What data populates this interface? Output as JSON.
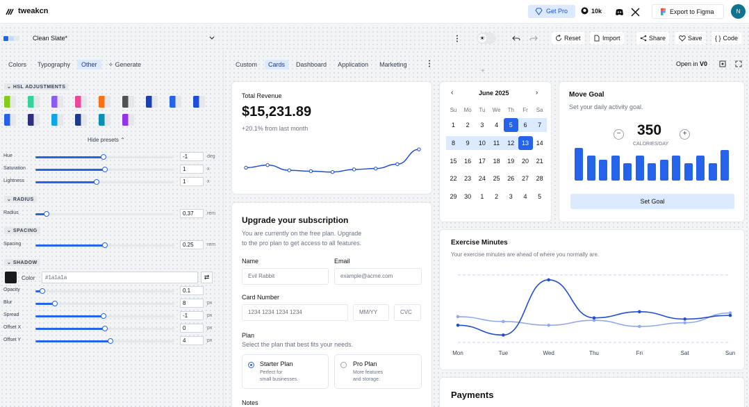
{
  "app": {
    "brand": "tweakcn"
  },
  "topbar": {
    "get_pro": "Get Pro",
    "github_stars": "10k",
    "export": "Export to Figma",
    "avatar": "N"
  },
  "toolbar": {
    "theme_name": "Clean Slate*",
    "reset": "Reset",
    "import": "Import",
    "share": "Share",
    "save": "Save",
    "code": "Code",
    "swatch_colors": [
      "#2563eb",
      "#bfdbfe",
      "#e5e7eb"
    ]
  },
  "left": {
    "tabs": [
      "Colors",
      "Typography",
      "Other",
      "Generate"
    ],
    "active_tab": "Other",
    "hsl_title": "HSL ADJUSTMENTS",
    "presets_row1": [
      "#84cc16",
      "#34d399",
      "#8b5cf6",
      "#ec4899",
      "#f97316",
      "#525252",
      "#1e40af",
      "#2563eb",
      "#1d4ed8"
    ],
    "presets_row2": [
      "#2563eb",
      "#312e81",
      "#0ea5e9",
      "#1e3a8a",
      "#0891b2",
      "#9333ea"
    ],
    "hide_presets": "Hide presets",
    "sliders": {
      "hue": {
        "label": "Hue",
        "value": "-1",
        "unit": "deg",
        "pct": 0.49
      },
      "saturation": {
        "label": "Saturation",
        "value": "1",
        "unit": "x",
        "pct": 0.5
      },
      "lightness": {
        "label": "Lightness",
        "value": "1",
        "unit": "x",
        "pct": 0.44
      }
    },
    "radius_title": "RADIUS",
    "radius": {
      "label": "Radius",
      "value": "0.37",
      "unit": "rem",
      "pct": 0.08
    },
    "spacing_title": "SPACING",
    "spacing": {
      "label": "Spacing",
      "value": "0.25",
      "unit": "rem",
      "pct": 0.5
    },
    "shadow_title": "SHADOW",
    "shadow_color": {
      "label": "Color",
      "value": "#1a1a1a"
    },
    "shadow": {
      "opacity": {
        "label": "Opacity",
        "value": "0.1",
        "unit": "",
        "pct": 0.05
      },
      "blur": {
        "label": "Blur",
        "value": "8",
        "unit": "px",
        "pct": 0.14
      },
      "spread": {
        "label": "Spread",
        "value": "-1",
        "unit": "px",
        "pct": 0.49
      },
      "offset_x": {
        "label": "Offset X",
        "value": "0",
        "unit": "px",
        "pct": 0.5
      },
      "offset_y": {
        "label": "Offset Y",
        "value": "4",
        "unit": "px",
        "pct": 0.54
      }
    }
  },
  "center_tabs": [
    "Custom",
    "Cards",
    "Dashboard",
    "Application",
    "Marketing"
  ],
  "center_active": "Cards",
  "open_in": "Open in",
  "revenue": {
    "title": "Total Revenue",
    "amount": "$15,231.89",
    "change": "+20.1% from last month"
  },
  "upgrade": {
    "title": "Upgrade your subscription",
    "desc1": "You are currently on the free plan. Upgrade",
    "desc2": "to the pro plan to get access to all features.",
    "name_label": "Name",
    "name_value": "Evil Rabbit",
    "email_label": "Email",
    "email_placeholder": "example@acme.com",
    "card_label": "Card Number",
    "card_placeholder": "1234 1234 1234 1234",
    "exp_placeholder": "MM/YY",
    "cvc_placeholder": "CVC",
    "plan_label": "Plan",
    "plan_desc": "Select the plan that best fits your needs.",
    "starter_title": "Starter Plan",
    "starter_desc1": "Perfect for",
    "starter_desc2": "small businesses.",
    "pro_title": "Pro Plan",
    "pro_desc1": "More features",
    "pro_desc2": "and storage.",
    "notes_label": "Notes"
  },
  "calendar": {
    "month": "June 2025",
    "weekdays": [
      "Su",
      "Mo",
      "Tu",
      "We",
      "Th",
      "Fr",
      "Sa"
    ],
    "weeks": [
      [
        "1",
        "2",
        "3",
        "4",
        "5",
        "6",
        "7"
      ],
      [
        "8",
        "9",
        "10",
        "11",
        "12",
        "13",
        "14"
      ],
      [
        "15",
        "16",
        "17",
        "18",
        "19",
        "20",
        "21"
      ],
      [
        "22",
        "23",
        "24",
        "25",
        "26",
        "27",
        "28"
      ],
      [
        "29",
        "30",
        "1",
        "2",
        "3",
        "4",
        "5"
      ]
    ],
    "selected": [
      "5",
      "13"
    ],
    "range": [
      "6",
      "7",
      "8",
      "9",
      "10",
      "11",
      "12"
    ]
  },
  "goal": {
    "title": "Move Goal",
    "desc": "Set your daily activity goal.",
    "value": "350",
    "unit": "CALORIES/DAY",
    "button": "Set Goal",
    "bars": [
      0.95,
      0.72,
      0.6,
      0.72,
      0.5,
      0.72,
      0.5,
      0.6,
      0.72,
      0.5,
      0.72,
      0.5,
      0.88
    ]
  },
  "exercise": {
    "title": "Exercise Minutes",
    "desc": "Your exercise minutes are ahead of where you normally are."
  },
  "payments": {
    "title": "Payments"
  },
  "chart_data": [
    {
      "type": "line",
      "series": [
        {
          "values": [
            25,
            28,
            22,
            21,
            20,
            23,
            24,
            29,
            46
          ]
        }
      ]
    },
    {
      "type": "line",
      "categories": [
        "Mon",
        "Tue",
        "Wed",
        "Thu",
        "Fri",
        "Sat",
        "Sun"
      ],
      "series": [
        {
          "values": [
            240,
            160,
            610,
            300,
            350,
            290,
            320
          ],
          "color": "#1d4ed8"
        },
        {
          "values": [
            310,
            270,
            240,
            280,
            230,
            260,
            340
          ],
          "color": "#93a9ee"
        }
      ],
      "ylim": [
        100,
        700
      ]
    }
  ]
}
